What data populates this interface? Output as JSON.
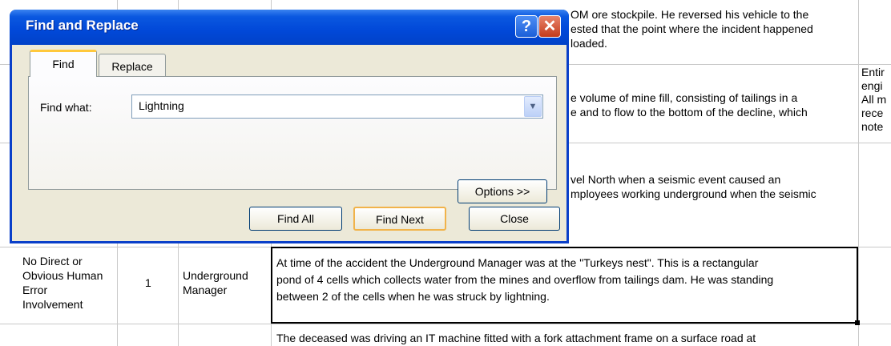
{
  "dialog": {
    "title": "Find and Replace",
    "help_glyph": "?",
    "close_glyph": "✕",
    "tabs": [
      {
        "label": "Find"
      },
      {
        "label": "Replace"
      }
    ],
    "find_what_label": "Find what:",
    "find_what_value": "Lightning",
    "options_label": "Options >>",
    "find_all_label": "Find All",
    "find_next_label": "Find Next",
    "close_label": "Close",
    "dropdown_glyph": "▼"
  },
  "sheet": {
    "row1_desc": [
      "OM ore stockpile. He reversed his vehicle to the",
      "ested that the point where the incident happened",
      " loaded."
    ],
    "row2_desc": [
      "e volume of mine fill, consisting of tailings in a",
      "e and to flow to the bottom of the decline, which"
    ],
    "row2_notes": [
      "Entir",
      "engi",
      "All m",
      "rece",
      "note"
    ],
    "row3_desc": [
      "vel North when a seismic event caused an",
      "mployees working underground when the seismic"
    ],
    "row4": {
      "cause": [
        "No Direct or",
        "Obvious Human",
        "Error",
        "Involvement"
      ],
      "count": "1",
      "role": [
        "Underground",
        "Manager"
      ],
      "desc": [
        "At time of the accident the Underground Manager was at the \"Turkeys nest\". This is a rectangular",
        "pond of 4 cells which collects water from the mines and overflow from tailings dam. He was standing",
        "between 2 of the cells when he was struck by lightning."
      ]
    },
    "row5_desc": "The deceased was driving an IT machine fitted with a fork attachment frame on a surface road at"
  }
}
